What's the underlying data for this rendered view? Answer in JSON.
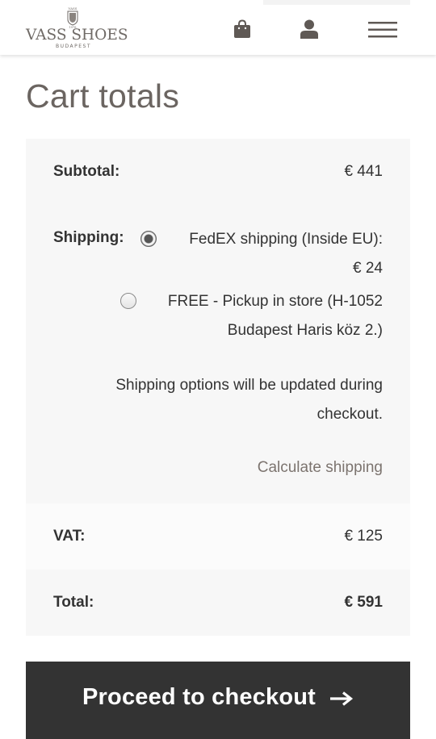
{
  "header": {
    "logo": {
      "name": "VASS SHOES",
      "city": "BUDAPEST",
      "crest_top": "VASS",
      "crest_year": "1978"
    },
    "icons": [
      "shopping-bag-icon",
      "user-icon",
      "hamburger-menu-icon"
    ]
  },
  "page": {
    "title": "Cart totals"
  },
  "totals": {
    "subtotal": {
      "label": "Subtotal:",
      "value": "€ 441"
    },
    "shipping": {
      "label": "Shipping:",
      "options": [
        {
          "line1": "FedEX shipping (Inside EU):",
          "line2": "€ 24",
          "selected": true
        },
        {
          "line1": "FREE - Pickup in store (H-1052",
          "line2": "Budapest Haris köz 2.)",
          "selected": false
        }
      ],
      "note_line1": "Shipping options will be updated during",
      "note_line2": "checkout.",
      "calc_link": "Calculate shipping"
    },
    "vat": {
      "label": "VAT:",
      "value": "€ 125"
    },
    "total": {
      "label": "Total:",
      "value": "€ 591"
    }
  },
  "checkout": {
    "label": "Proceed to checkout"
  },
  "colors": {
    "button_bg": "#333333",
    "title_text": "#6b6561",
    "link_text": "#7c746f",
    "row_bg": "#f7f7f7"
  }
}
